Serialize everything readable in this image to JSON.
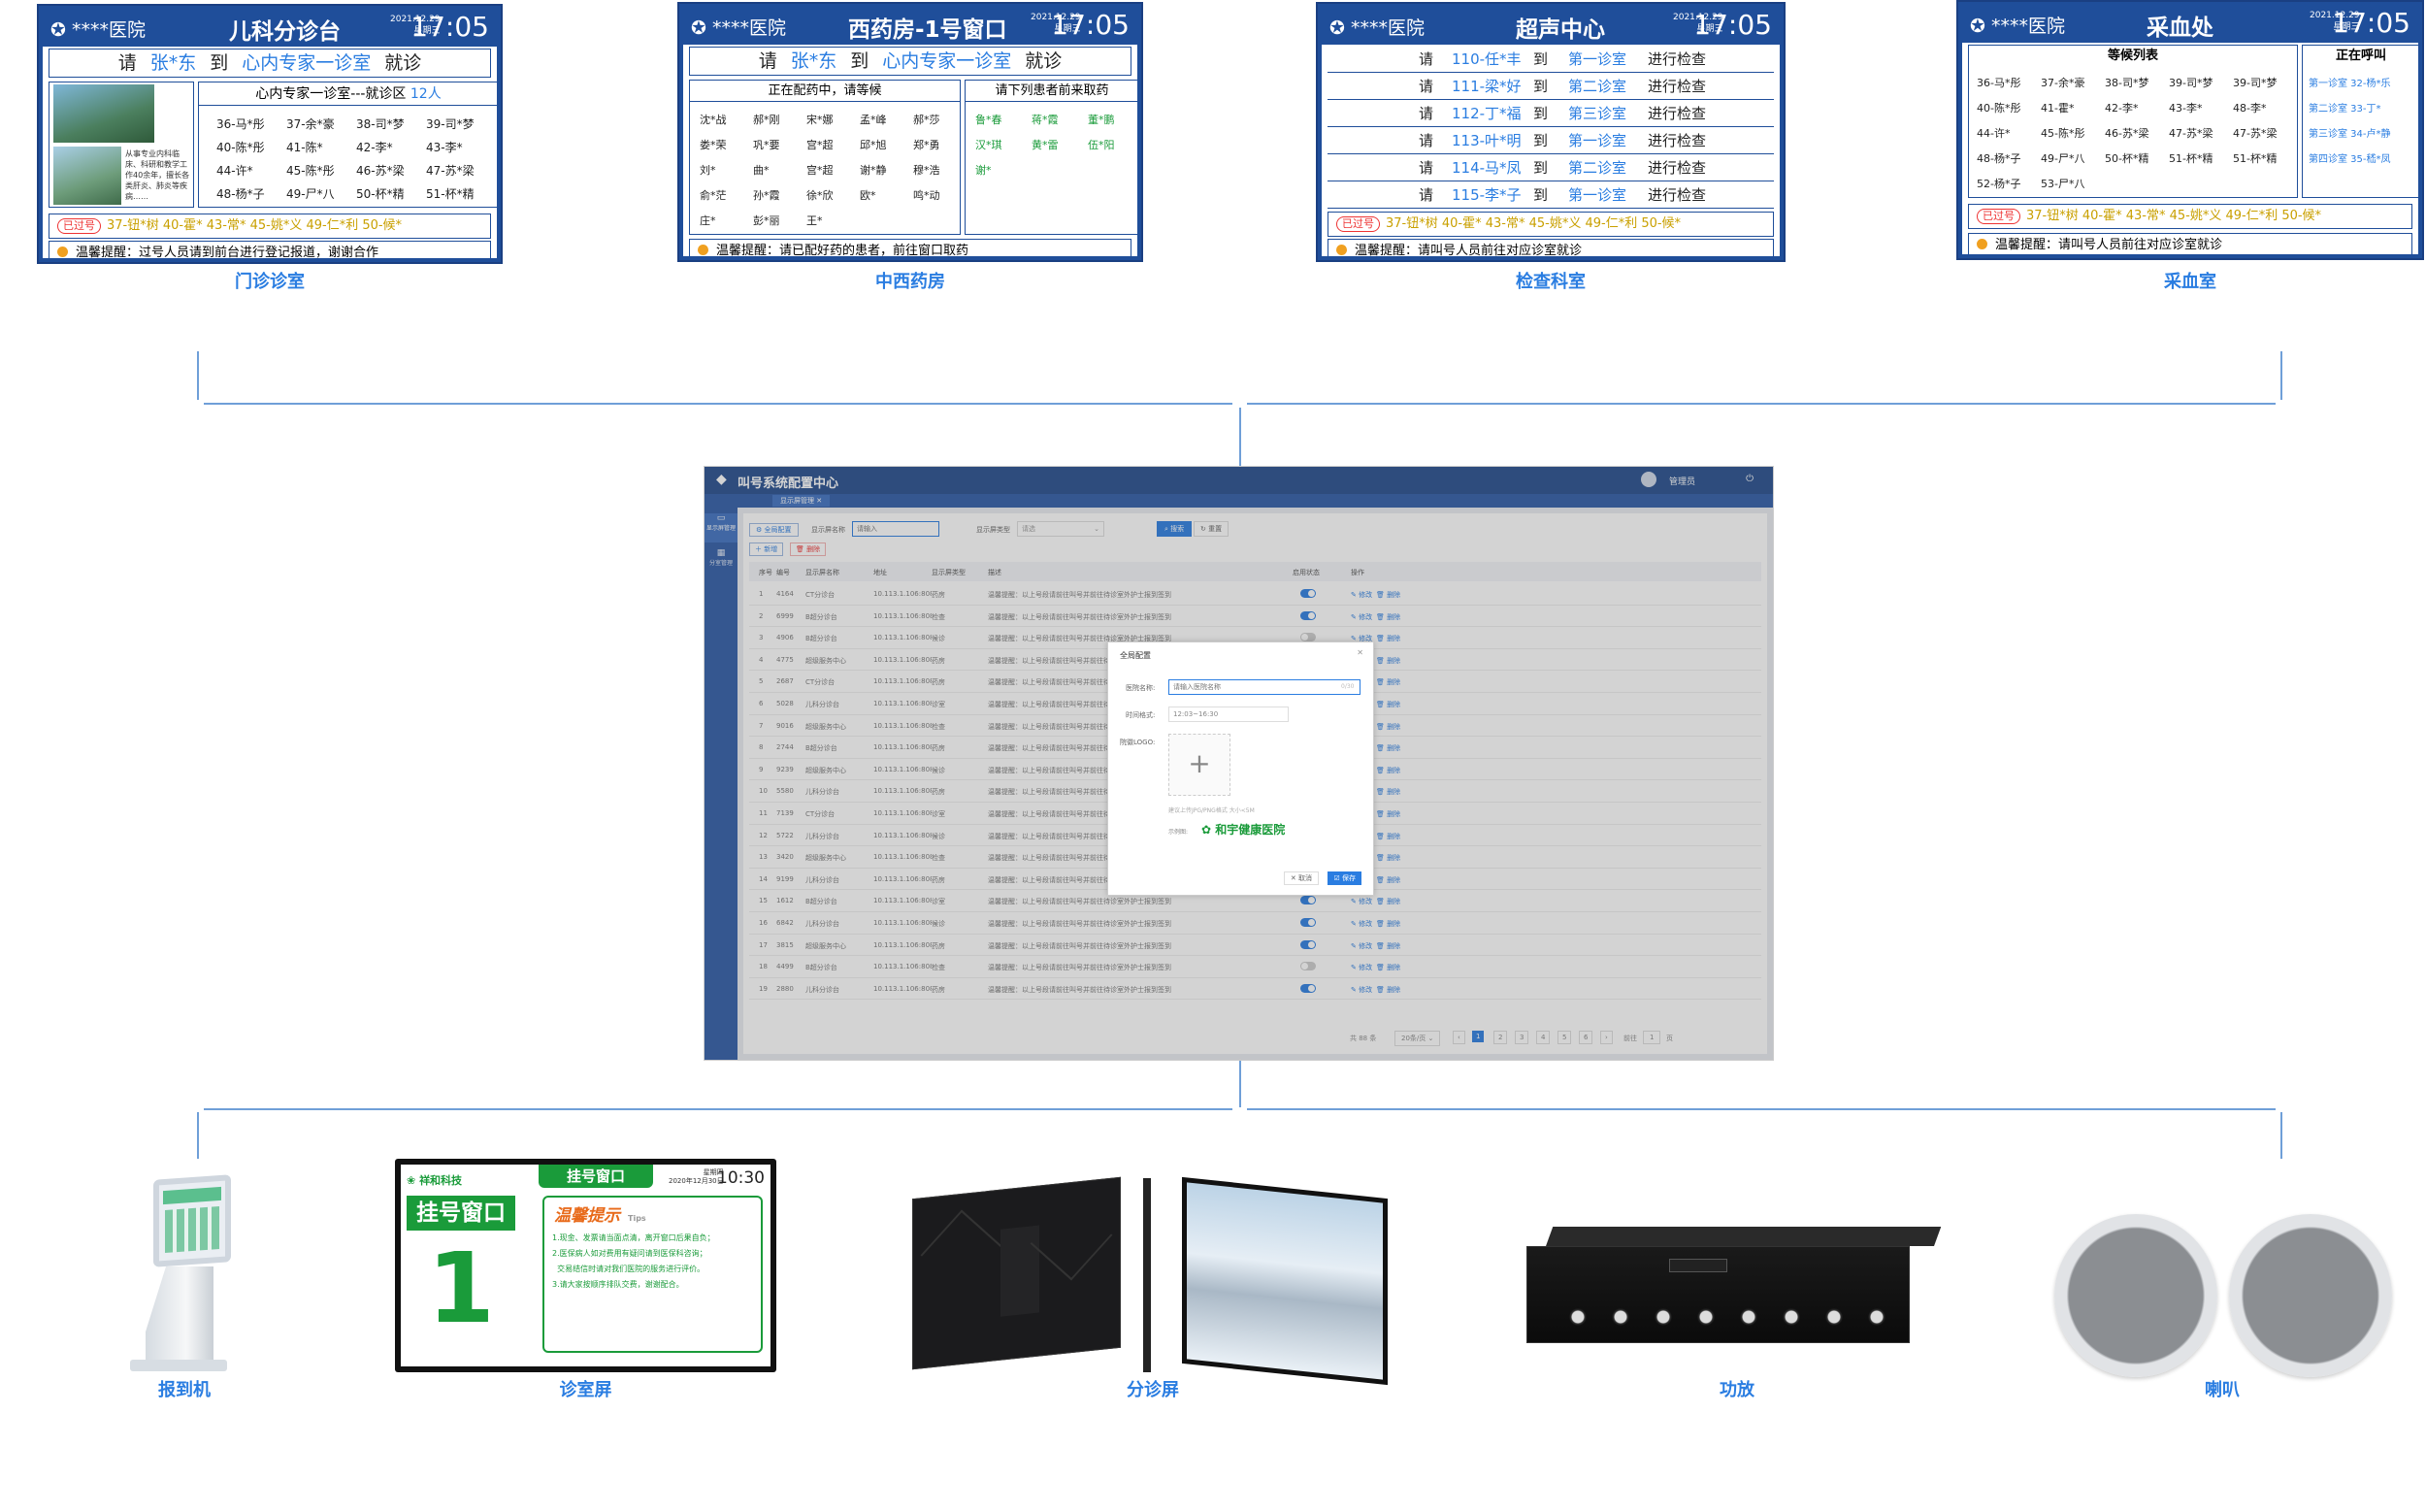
{
  "panels": [
    {
      "id": "outpatient",
      "hospital": "****医院",
      "dept": "儿科分诊台",
      "date": "2021.12.29",
      "weekday": "星期三",
      "time": "17:05",
      "call_prefix": "请",
      "call_name": "张*东",
      "call_mid": "到",
      "call_room": "心内专家一诊室",
      "call_suffix": "就诊",
      "section_title": "心内专家一诊室---就诊区",
      "section_count": "12人",
      "side_text": "从事专业内科临床、科研和教学工作40余年，擅长各类肝炎、肺炎等疾病……",
      "queue": [
        "36-马*彤",
        "37-余*豪",
        "38-司*梦",
        "39-司*梦",
        "40-陈*彤",
        "41-陈*",
        "42-李*",
        "43-李*",
        "44-许*",
        "45-陈*彤",
        "46-苏*梁",
        "47-苏*梁",
        "48-杨*子",
        "49-尸*八",
        "50-杯*精",
        "51-杯*精"
      ],
      "passed_label": "已过号",
      "passed": "37-钮*树  40-霍*  43-常*  45-姚*义  49-仁*利  50-候*",
      "tip": "温馨提醒：过号人员请到前台进行登记报道，谢谢合作",
      "caption": "门诊诊室"
    },
    {
      "id": "pharmacy",
      "hospital": "****医院",
      "dept": "西药房-1号窗口",
      "date": "2021.12.29",
      "weekday": "星期三",
      "time": "17:05",
      "call_prefix": "请",
      "call_name": "张*东",
      "call_mid": "到",
      "call_room": "心内专家一诊室",
      "call_suffix": "就诊",
      "left_title": "正在配药中，请等候",
      "right_title": "请下列患者前来取药",
      "waiting": [
        "沈*战",
        "郝*刚",
        "宋*娜",
        "孟*峰",
        "郝*莎",
        "娄*荣",
        "巩*要",
        "宫*超",
        "邱*旭",
        "郑*勇",
        "刘*",
        "曲*",
        "宫*超",
        "谢*静",
        "穆*浩",
        "俞*茫",
        "孙*霞",
        "徐*欣",
        "欧*",
        "鸣*动",
        "庄*",
        "彭*丽",
        "王*"
      ],
      "ready": [
        "鲁*春",
        "蒋*霞",
        "董*鹏",
        "汉*琪",
        "黄*雷",
        "伍*阳",
        "谢*"
      ],
      "tip": "温馨提醒：请已配好药的患者，前往窗口取药",
      "caption": "中西药房"
    },
    {
      "id": "exam",
      "hospital": "****医院",
      "dept": "超声中心",
      "date": "2021.12.29",
      "weekday": "星期三",
      "time": "17:05",
      "rows": [
        {
          "pre": "请",
          "name": "110-任*丰",
          "mid": "到",
          "room": "第一诊室",
          "status": "进行检查"
        },
        {
          "pre": "请",
          "name": "111-梁*好",
          "mid": "到",
          "room": "第二诊室",
          "status": "进行检查"
        },
        {
          "pre": "请",
          "name": "112-丁*福",
          "mid": "到",
          "room": "第三诊室",
          "status": "进行检查"
        },
        {
          "pre": "请",
          "name": "113-叶*明",
          "mid": "到",
          "room": "第一诊室",
          "status": "进行检查"
        },
        {
          "pre": "请",
          "name": "114-马*凤",
          "mid": "到",
          "room": "第二诊室",
          "status": "进行检查"
        },
        {
          "pre": "请",
          "name": "115-李*子",
          "mid": "到",
          "room": "第一诊室",
          "status": "进行检查"
        }
      ],
      "passed_label": "已过号",
      "passed": "37-钮*树  40-霍*  43-常*  45-姚*义  49-仁*利  50-候*",
      "tip": "温馨提醒：请叫号人员前往对应诊室就诊",
      "caption": "检查科室"
    },
    {
      "id": "blood",
      "hospital": "****医院",
      "dept": "采血处",
      "date": "2021.12.29",
      "weekday": "星期三",
      "time": "17:05",
      "left_title": "等候列表",
      "right_title": "正在呼叫",
      "waiting": [
        "36-马*彤",
        "37-余*豪",
        "38-司*梦",
        "39-司*梦",
        "39-司*梦",
        "40-陈*彤",
        "41-霍*",
        "42-李*",
        "43-李*",
        "48-李*",
        "44-许*",
        "45-陈*彤",
        "46-苏*梁",
        "47-苏*梁",
        "47-苏*梁",
        "48-杨*子",
        "49-尸*八",
        "50-杯*精",
        "51-杯*精",
        "51-杯*精",
        "52-杨*子",
        "53-尸*八"
      ],
      "calling": [
        "第一诊室  32-杨*乐",
        "第二诊室  33-丁*",
        "第三诊室  34-卢*静",
        "第四诊室  35-嵇*凤"
      ],
      "passed_label": "已过号",
      "passed": "37-钮*树  40-霍*  43-常*  45-姚*义  49-仁*利  50-候*",
      "tip": "温馨提醒：请叫号人员前往对应诊室就诊",
      "caption": "采血室"
    }
  ],
  "admin": {
    "title": "叫号系统配置中心",
    "user": "管理员",
    "tab": "显示屏管理",
    "side_items": [
      "显示屏管理",
      "分室管理"
    ],
    "toolbar": {
      "global": "全局配置",
      "name_label": "显示屏名称",
      "name_placeholder": "请输入",
      "type_label": "显示屏类型",
      "type_value": "请选",
      "search": "搜索",
      "reset": "重置",
      "add": "新增",
      "delete": "删除"
    },
    "columns": [
      "序号",
      "编号",
      "显示屏名称",
      "地址",
      "显示屏类型",
      "描述",
      "启用状态",
      "操作"
    ],
    "rows": [
      {
        "no": "1",
        "code": "4164",
        "name": "CT分诊台",
        "addr": "10.113.1.106:8080",
        "type": "药房",
        "desc": "温馨提醒：以上号段请前往叫号并前往待诊室外护士报到签到",
        "on": true
      },
      {
        "no": "2",
        "code": "6999",
        "name": "B超分诊台",
        "addr": "10.113.1.106:8080",
        "type": "检查",
        "desc": "温馨提醒：以上号段请前往叫号并前往待诊室外护士报到签到",
        "on": true
      },
      {
        "no": "3",
        "code": "4906",
        "name": "B超分诊台",
        "addr": "10.113.1.106:8080",
        "type": "候诊",
        "desc": "温馨提醒：以上号段请前往叫号并前往待诊室外护士报到签到",
        "on": false
      },
      {
        "no": "4",
        "code": "4775",
        "name": "超级服务中心",
        "addr": "10.113.1.106:8080",
        "type": "药房",
        "desc": "温馨提醒：以上号段请前往叫号并前往待诊室外护士报到签到",
        "on": true
      },
      {
        "no": "5",
        "code": "2687",
        "name": "CT分诊台",
        "addr": "10.113.1.106:8080",
        "type": "药房",
        "desc": "温馨提醒：以上号段请前往叫号并前往待诊室外护士报到签到",
        "on": false
      },
      {
        "no": "6",
        "code": "5028",
        "name": "儿科分诊台",
        "addr": "10.113.1.106:8080",
        "type": "诊室",
        "desc": "温馨提醒：以上号段请前往叫号并前往待诊室外护士报到签到",
        "on": true
      },
      {
        "no": "7",
        "code": "9016",
        "name": "超级服务中心",
        "addr": "10.113.1.106:8080",
        "type": "检查",
        "desc": "温馨提醒：以上号段请前往叫号并前往待诊室外护士报到签到",
        "on": false
      },
      {
        "no": "8",
        "code": "2744",
        "name": "B超分诊台",
        "addr": "10.113.1.106:8080",
        "type": "药房",
        "desc": "温馨提醒：以上号段请前往叫号并前往待诊室外护士报到签到",
        "on": true
      },
      {
        "no": "9",
        "code": "9239",
        "name": "超级服务中心",
        "addr": "10.113.1.106:8080",
        "type": "候诊",
        "desc": "温馨提醒：以上号段请前往叫号并前往待诊室外护士报到签到",
        "on": true
      },
      {
        "no": "10",
        "code": "5580",
        "name": "儿科分诊台",
        "addr": "10.113.1.106:8080",
        "type": "药房",
        "desc": "温馨提醒：以上号段请前往叫号并前往待诊室外护士报到签到",
        "on": true
      },
      {
        "no": "11",
        "code": "7139",
        "name": "CT分诊台",
        "addr": "10.113.1.106:8080",
        "type": "诊室",
        "desc": "温馨提醒：以上号段请前往叫号并前往待诊室外护士报到签到",
        "on": false
      },
      {
        "no": "12",
        "code": "5722",
        "name": "儿科分诊台",
        "addr": "10.113.1.106:8080",
        "type": "候诊",
        "desc": "温馨提醒：以上号段请前往叫号并前往待诊室外护士报到签到",
        "on": true
      },
      {
        "no": "13",
        "code": "3420",
        "name": "超级服务中心",
        "addr": "10.113.1.106:8080",
        "type": "检查",
        "desc": "温馨提醒：以上号段请前往叫号并前往待诊室外护士报到签到",
        "on": false
      },
      {
        "no": "14",
        "code": "9199",
        "name": "儿科分诊台",
        "addr": "10.113.1.106:8080",
        "type": "药房",
        "desc": "温馨提醒：以上号段请前往叫号并前往待诊室外护士报到签到",
        "on": true
      },
      {
        "no": "15",
        "code": "1612",
        "name": "B超分诊台",
        "addr": "10.113.1.106:8080",
        "type": "诊室",
        "desc": "温馨提醒：以上号段请前往叫号并前往待诊室外护士报到签到",
        "on": true
      },
      {
        "no": "16",
        "code": "6842",
        "name": "儿科分诊台",
        "addr": "10.113.1.106:8080",
        "type": "候诊",
        "desc": "温馨提醒：以上号段请前往叫号并前往待诊室外护士报到签到",
        "on": true
      },
      {
        "no": "17",
        "code": "3815",
        "name": "超级服务中心",
        "addr": "10.113.1.106:8080",
        "type": "药房",
        "desc": "温馨提醒：以上号段请前往叫号并前往待诊室外护士报到签到",
        "on": true
      },
      {
        "no": "18",
        "code": "4499",
        "name": "B超分诊台",
        "addr": "10.113.1.106:8080",
        "type": "检查",
        "desc": "温馨提醒：以上号段请前往叫号并前往待诊室外护士报到签到",
        "on": false
      },
      {
        "no": "19",
        "code": "2880",
        "name": "儿科分诊台",
        "addr": "10.113.1.106:8080",
        "type": "药房",
        "desc": "温馨提醒：以上号段请前往叫号并前往待诊室外护士报到签到",
        "on": true
      }
    ],
    "row_actions": [
      "修改",
      "删除"
    ],
    "pagination": {
      "total": "共 88 条",
      "per_page": "20条/页",
      "pages": [
        "1",
        "2",
        "3",
        "4",
        "5",
        "6"
      ],
      "goto": "前往",
      "goto_page": "1",
      "page_unit": "页"
    },
    "modal": {
      "title": "全局配置",
      "name_label": "医院名称:",
      "name_placeholder": "请输入医院名称",
      "count": "0/30",
      "time_label": "时间格式:",
      "time_value": "12:03~16:30",
      "logo_label": "院徽LOGO:",
      "upload_hint": "建议上传JPG/PNG格式 大小<5M",
      "example_label": "示例图:",
      "example_logo": "和宇健康医院",
      "cancel": "取消",
      "confirm": "保存"
    }
  },
  "devices": [
    {
      "label": "报到机"
    },
    {
      "label": "诊室屏",
      "screen_title": "挂号窗口",
      "brand": "祥和科技",
      "date": "2020年12月30日",
      "weekday": "星期四",
      "time": "10:30",
      "big_label": "挂号窗口",
      "big_number": "1",
      "tips_title": "温馨提示",
      "tips_tag": "Tips",
      "tips": [
        "1.现金、发票请当面点清，离开窗口后果自负；",
        "2.医保病人如对费用有疑问请到医保科咨询；",
        "  交易结信时请对我们医院的服务进行评价。",
        "3.请大家按顺序排队交费，谢谢配合。"
      ]
    },
    {
      "label": "分诊屏"
    },
    {
      "label": "功放"
    },
    {
      "label": "喇叭"
    }
  ],
  "colors": {
    "brand_blue": "#1f4e9a",
    "accent_blue": "#2a7de1",
    "green": "#1a9b3a",
    "warn_orange": "#f0a020",
    "passed_red": "#e33333"
  }
}
